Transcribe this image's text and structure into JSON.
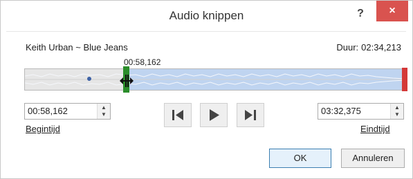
{
  "window": {
    "title": "Audio knippen",
    "help_label": "?",
    "close_label": "×"
  },
  "media": {
    "song": "Keith Urban ~ Blue Jeans",
    "duration_label": "Duur:",
    "duration_value": "02:34,213"
  },
  "timeline": {
    "start_time_label": "00:58,162"
  },
  "start": {
    "value": "00:58,162",
    "label": "Begintijd"
  },
  "end": {
    "value": "03:32,375",
    "label": "Eindtijd"
  },
  "buttons": {
    "ok": "OK",
    "cancel": "Annuleren"
  },
  "icons": {
    "up": "▲",
    "down": "▼",
    "prev_frame": "previous-frame-icon",
    "play": "play-icon",
    "next_frame": "next-frame-icon"
  },
  "colors": {
    "selection": "#bfd4f0",
    "start_marker": "#2a8d2a",
    "end_marker": "#d43838",
    "close_button": "#d9534f"
  }
}
